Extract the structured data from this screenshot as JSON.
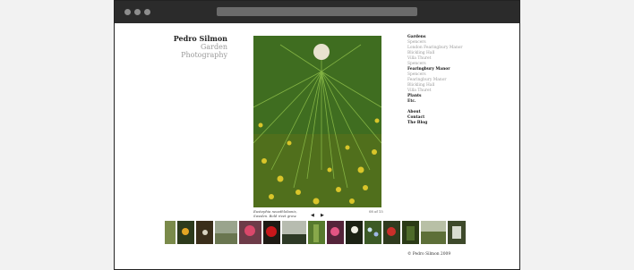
{
  "site": {
    "name": "Pedro Silmon",
    "subtitle": "Garden Photography"
  },
  "caption": {
    "line1": "Eustephia neoathlobanis,",
    "line2": "Sweden. Bold rivet grow."
  },
  "counter": "08 of 15",
  "nav": {
    "gardens": {
      "label": "Gardens",
      "items": [
        "Spencers",
        "London Fearingbury Manor",
        "Blickling Hall",
        "Villa Thuret",
        "Spencers"
      ]
    },
    "fearingbury": {
      "label": "Fearingbury Manor",
      "items": [
        "Spencers",
        "Fearingbury Manor",
        "Blickling Hall",
        "Villa Thuret"
      ]
    },
    "plants": "Plants",
    "etc": "Etc.",
    "about": "About",
    "contact": "Contact",
    "blog": "The Blog"
  },
  "footer": "© Pedro Silmon 2009",
  "colors": {
    "frame_bar": "#2b2b2b",
    "accent_green": "#4d8a2a",
    "nav_gray": "#999999"
  },
  "thumbnails": [
    "thumb-1",
    "thumb-2",
    "thumb-3",
    "thumb-4",
    "thumb-5",
    "thumb-6",
    "thumb-7",
    "thumb-8",
    "thumb-9",
    "thumb-10",
    "thumb-11",
    "thumb-12",
    "thumb-13",
    "thumb-14",
    "thumb-15",
    "thumb-16"
  ]
}
